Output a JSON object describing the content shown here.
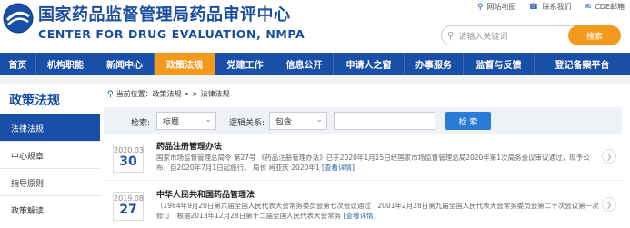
{
  "header": {
    "title_cn": "国家药品监督管理局药品审评中心",
    "title_en": "CENTER FOR DRUG EVALUATION, NMPA",
    "links": [
      {
        "icon": "map-pin-icon",
        "label": "网站地图"
      },
      {
        "icon": "phone-icon",
        "label": "联系我们"
      },
      {
        "icon": "mail-icon",
        "label": "CDE邮箱"
      }
    ],
    "search": {
      "placeholder": "请输入关键词",
      "button_label": "搜索"
    }
  },
  "nav": {
    "items": [
      "首页",
      "机构职能",
      "新闻中心",
      "政策法规",
      "党建工作",
      "信息公开",
      "申请人之窗",
      "办事服务",
      "监督与反馈",
      "登记备案平台"
    ],
    "active_index": 3
  },
  "sidebar": {
    "title": "政策法规",
    "items": [
      "法律法规",
      "中心规章",
      "指导原则",
      "政策解读"
    ],
    "active_index": 0
  },
  "breadcrumb": {
    "text": "当前位置：政策法规 > > 法律法规"
  },
  "filter": {
    "search_label": "检索:",
    "field_value": "标题",
    "logic_label": "逻辑关系:",
    "logic_value": "包含",
    "button_label": "检 索"
  },
  "list": [
    {
      "year_month": "2020.03",
      "day": "30",
      "title": "药品注册管理办法",
      "desc": "国家市场监督管理总局令 第27号 《药品注册管理办法》已于2020年1月15日经国家市场监督管理总局2020年第1次局务会议审议通过，现予公布，自2020年7月1日起施行。 局长 肖亚庆 2020年1",
      "more": "[查看详情]"
    },
    {
      "year_month": "2019.08",
      "day": "27",
      "title": "中华人民共和国药品管理法",
      "desc": "（1984年9月20日第六届全国人民代表大会常务委员会第七次会议通过　2001年2月28日第九届全国人民代表大会常务委员会第二十次会议第一次修订　根据2013年12月28日第十二届全国人民代表大会常务",
      "more": "[查看详情]"
    }
  ],
  "colors": {
    "brand_blue": "#1a4fa8",
    "accent_orange": "#f39a1e",
    "button_blue": "#2a7bd6"
  }
}
